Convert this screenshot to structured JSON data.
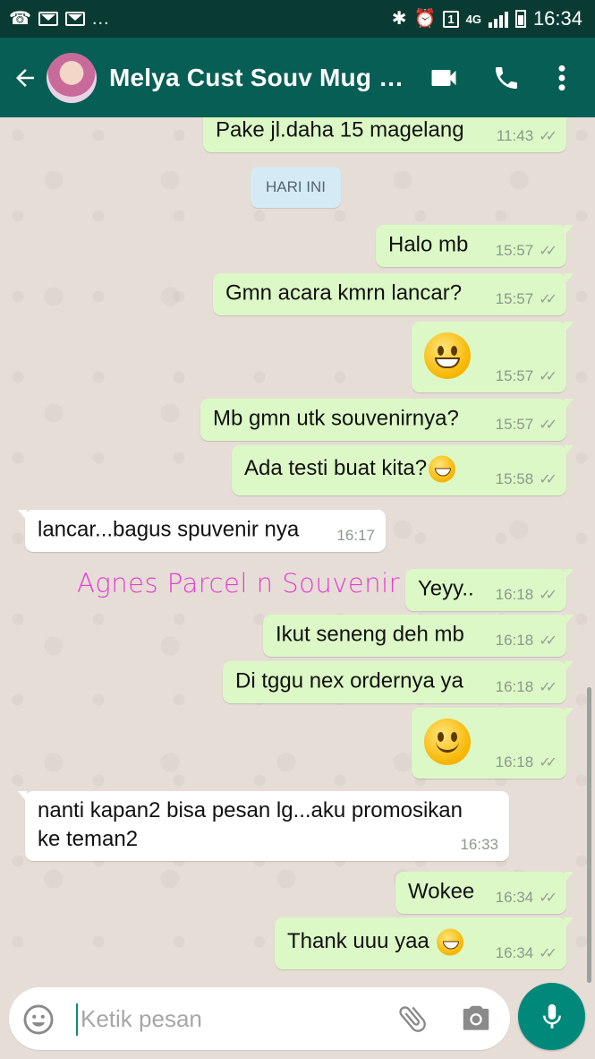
{
  "status_bar": {
    "notif_dots": "...",
    "network": "4G",
    "sim": "1",
    "time": "16:34"
  },
  "header": {
    "title": "Melya Cust Souv Mug K..."
  },
  "chat": {
    "date_separator": "HARI INI",
    "watermark": "Agnes Parcel n Souvenir",
    "messages": [
      {
        "dir": "out",
        "text": "Pake jl.daha 15 magelang",
        "time": "11:43"
      },
      {
        "dir": "out",
        "text": "Halo mb",
        "time": "15:57"
      },
      {
        "dir": "out",
        "text": "Gmn acara kmrn lancar?",
        "time": "15:57"
      },
      {
        "dir": "out",
        "text": "",
        "emoji": "grinning-face",
        "time": "15:57"
      },
      {
        "dir": "out",
        "text": "Mb gmn utk souvenirnya?",
        "time": "15:57"
      },
      {
        "dir": "out",
        "text": "Ada testi buat kita?",
        "emoji": "smiling-face",
        "time": "15:58"
      },
      {
        "dir": "in",
        "text": "lancar...bagus spuvenir nya",
        "time": "16:17"
      },
      {
        "dir": "out",
        "text": "Yeyy..",
        "time": "16:18"
      },
      {
        "dir": "out",
        "text": "Ikut seneng deh mb",
        "time": "16:18"
      },
      {
        "dir": "out",
        "text": "Di tggu nex ordernya ya",
        "time": "16:18"
      },
      {
        "dir": "out",
        "text": "",
        "emoji": "slightly-smiling-face",
        "time": "16:18"
      },
      {
        "dir": "in",
        "text_line1": "nanti kapan2 bisa pesan lg...aku promosikan",
        "text_line2": "ke teman2",
        "time": "16:33"
      },
      {
        "dir": "out",
        "text": "Wokee",
        "time": "16:34"
      },
      {
        "dir": "out",
        "text": "Thank uuu yaa",
        "emoji": "grinning-face",
        "time": "16:34"
      }
    ]
  },
  "input": {
    "placeholder": "Ketik pesan"
  },
  "colors": {
    "header": "#075e54",
    "status_bar": "#0a3b33",
    "outgoing": "#dcf8c6",
    "incoming": "#ffffff",
    "accent": "#00897b",
    "watermark": "#e63cd3"
  }
}
